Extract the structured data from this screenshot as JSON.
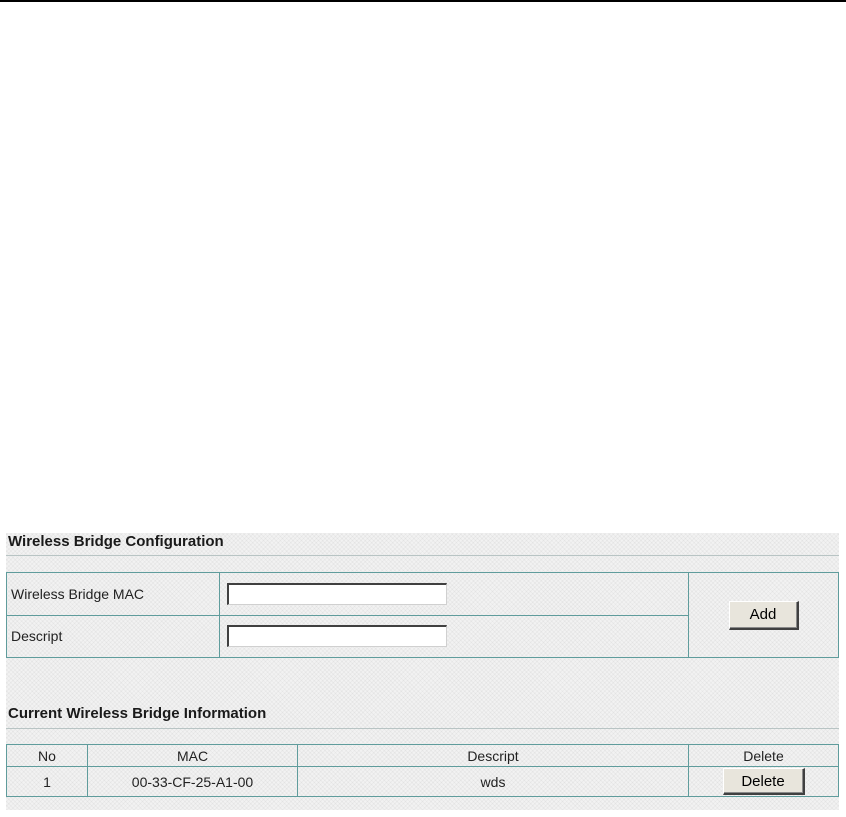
{
  "config": {
    "title": "Wireless Bridge Configuration",
    "mac_label": "Wireless Bridge MAC",
    "mac_value": "",
    "descript_label": "Descript",
    "descript_value": "",
    "add_label": "Add"
  },
  "info": {
    "title": "Current Wireless Bridge Information",
    "columns": [
      "No",
      "MAC",
      "Descript",
      "Delete"
    ],
    "rows": [
      {
        "no": "1",
        "mac": "00-33-CF-25-A1-00",
        "descript": "wds",
        "delete_label": "Delete"
      }
    ]
  },
  "colors": {
    "border": "#5f9c9c",
    "panel_bg": "#f2f2f2",
    "button_bg": "#e8e5dc"
  }
}
